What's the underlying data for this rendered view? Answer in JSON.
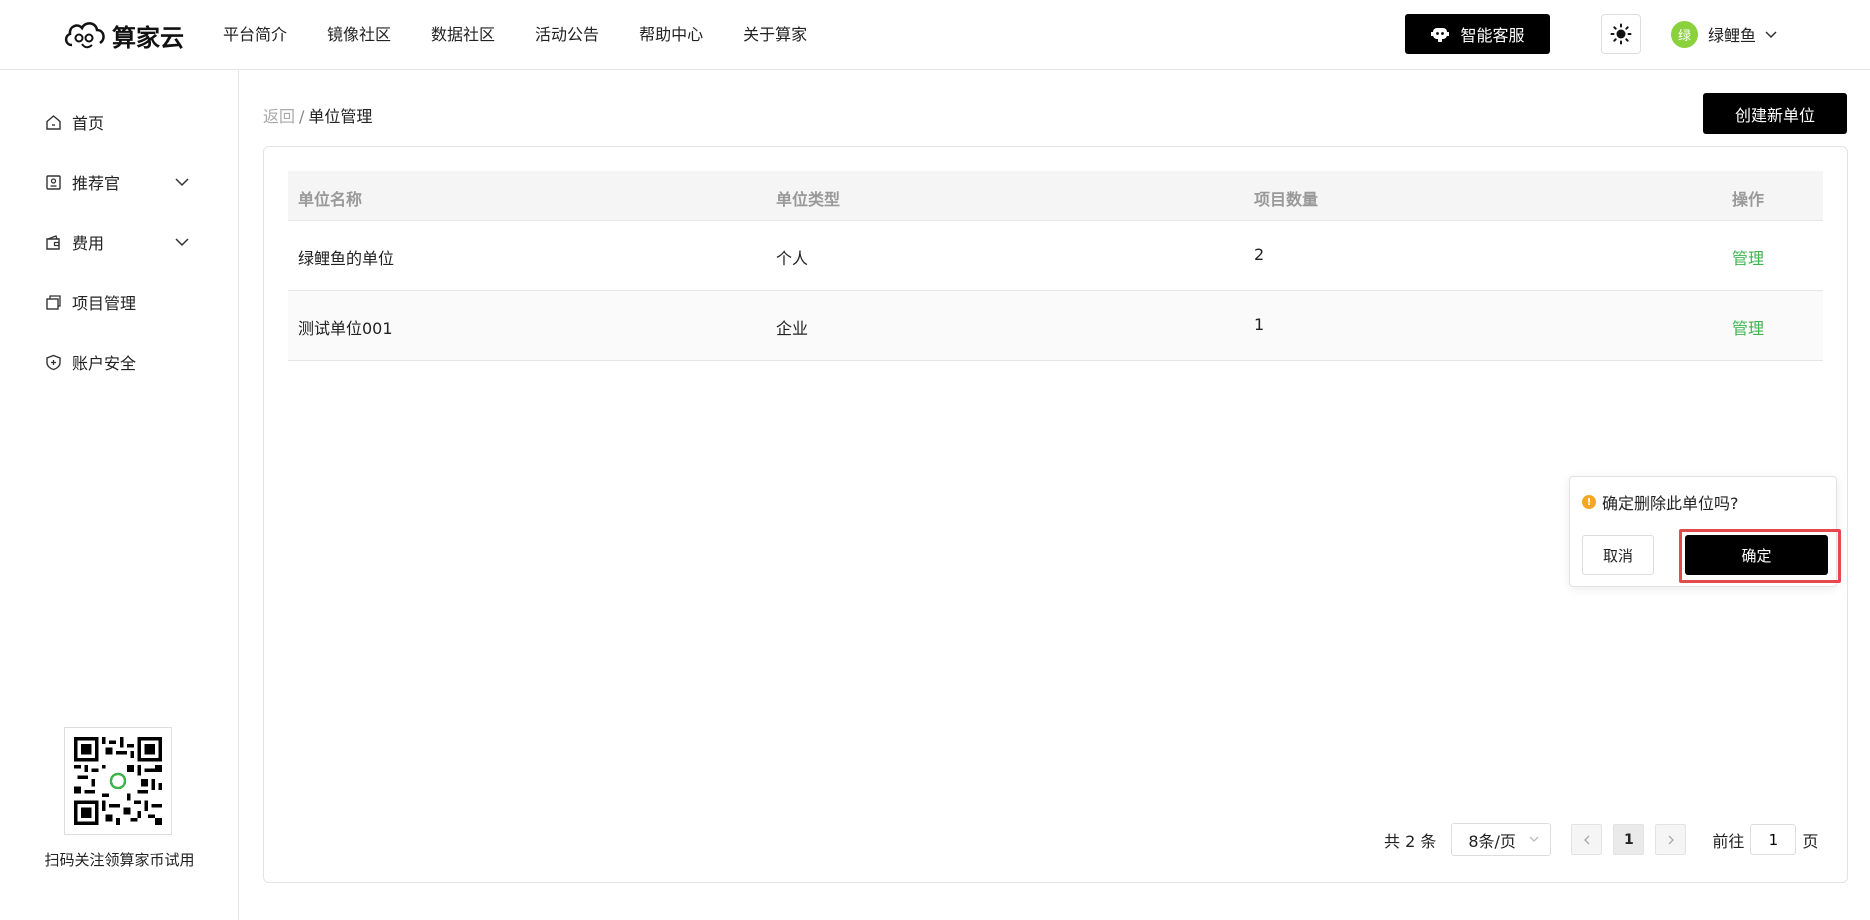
{
  "header": {
    "logo_text": "算家云",
    "nav": [
      "平台简介",
      "镜像社区",
      "数据社区",
      "活动公告",
      "帮助中心",
      "关于算家"
    ],
    "service_button": "智能客服",
    "user": {
      "avatar_text": "绿",
      "name": "绿鲤鱼"
    }
  },
  "sidebar": {
    "items": [
      {
        "label": "首页",
        "icon": "home-icon"
      },
      {
        "label": "推荐官",
        "icon": "badge-icon",
        "expandable": true
      },
      {
        "label": "费用",
        "icon": "wallet-icon",
        "expandable": true
      },
      {
        "label": "项目管理",
        "icon": "project-icon"
      },
      {
        "label": "账户安全",
        "icon": "shield-icon"
      }
    ],
    "qr_caption": "扫码关注领算家币试用"
  },
  "main": {
    "breadcrumb": {
      "back": "返回",
      "separator": "/",
      "current": "单位管理"
    },
    "create_button": "创建新单位",
    "table": {
      "headers": [
        "单位名称",
        "单位类型",
        "项目数量",
        "操作"
      ],
      "rows": [
        {
          "name": "绿鲤鱼的单位",
          "type": "个人",
          "count": "2",
          "action": "管理"
        },
        {
          "name": "测试单位001",
          "type": "企业",
          "count": "1",
          "action": "管理"
        }
      ]
    },
    "pagination": {
      "total": "共 2 条",
      "page_size": "8条/页",
      "current_page": "1",
      "goto_label": "前往",
      "goto_value": "1",
      "goto_suffix": "页"
    }
  },
  "popconfirm": {
    "message": "确定删除此单位吗?",
    "cancel": "取消",
    "confirm": "确定"
  },
  "colors": {
    "accent_green": "#3fb34f",
    "avatar_green": "#8bd13c",
    "warning": "#f5a623",
    "highlight_red": "#e5484d"
  }
}
